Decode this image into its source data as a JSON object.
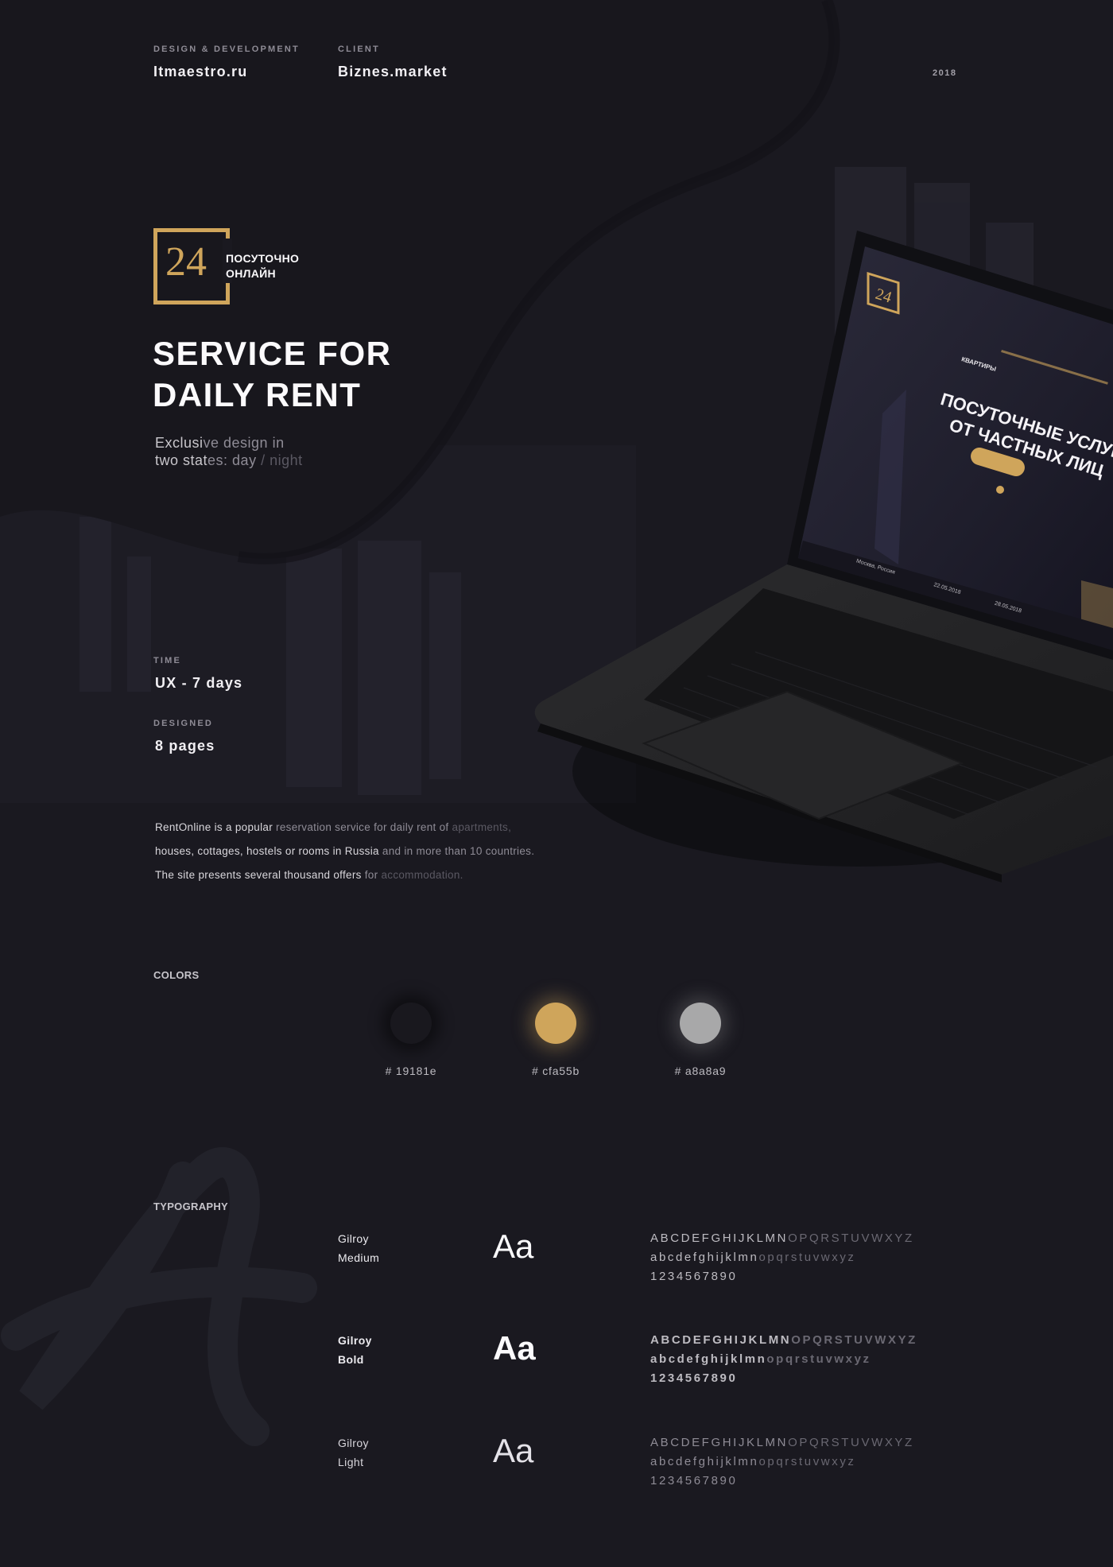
{
  "header": {
    "design_label": "DESIGN & DEVELOPMENT",
    "design_value": "Itmaestro.ru",
    "client_label": "CLIENT",
    "client_value": "Biznes.market",
    "year": "2018"
  },
  "logo": {
    "number": "24",
    "line1": "ПОСУТОЧНО",
    "line2": "ОНЛАЙН"
  },
  "hero": {
    "title_line1": "SERVICE FOR",
    "title_line2": "DAILY RENT",
    "subtitle_line1_a": "Exclusi",
    "subtitle_line1_b": "ve design in",
    "subtitle_line2_a": "two stat",
    "subtitle_line2_b": "es: day ",
    "subtitle_line2_c": "/ night"
  },
  "meta": {
    "time_label": "TIME",
    "time_value": "UX - 7 days",
    "designed_label": "DESIGNED",
    "designed_value": "8 pages"
  },
  "description": {
    "line1_a": "RentOnline is a popular ",
    "line1_b": "reservation service for daily rent of ",
    "line1_c": "apartments,",
    "line2_a": "houses, cottages, hostels or rooms in Russia ",
    "line2_b": "and in more than 10 countries.",
    "line3_a": "The site presents several thousand offers ",
    "line3_b": "for ",
    "line3_c": "accommodation."
  },
  "laptop_screen": {
    "headline_line1": "ПОСУТОЧНЫЕ УСЛУГИ",
    "headline_line2": "ОТ ЧАСТНЫХ ЛИЦ",
    "nav_active": "КВАРТИРЫ",
    "location": "Москва, Россия",
    "date_from": "22.05.2018",
    "date_to": "28.05.2018"
  },
  "colors": {
    "label": "COLORS",
    "swatches": [
      {
        "hex": "#19181e",
        "label": "# 19181e"
      },
      {
        "hex": "#cfa55b",
        "label": "# cfa55b"
      },
      {
        "hex": "#a8a8a9",
        "label": "# a8a8a9"
      }
    ]
  },
  "typography": {
    "label": "TYPOGRAPHY",
    "fonts": [
      {
        "name1": "Gilroy",
        "name2": "Medium",
        "sample": "Aa",
        "upper_a": "ABCDEFGHIJKLMN",
        "upper_b": "OPQRSTUVWXYZ",
        "lower_a": "abcdefghijklmn",
        "lower_b": "opqrstuvwxyz",
        "digits": "1234567890"
      },
      {
        "name1": "Gilroy",
        "name2": "Bold",
        "sample": "Aa",
        "upper_a": "ABCDEFGHIJKLMN",
        "upper_b": "OPQRSTUVWXYZ",
        "lower_a": "abcdefghijklmn",
        "lower_b": "opqrstuvwxyz",
        "digits": "1234567890"
      },
      {
        "name1": "Gilroy",
        "name2": "Light",
        "sample": "Aa",
        "upper_a": "ABCDEFGHIJKLMN",
        "upper_b": "OPQRSTUVWXYZ",
        "lower_a": "abcdefghijklmn",
        "lower_b": "opqrstuvwxyz",
        "digits": "1234567890"
      }
    ]
  }
}
